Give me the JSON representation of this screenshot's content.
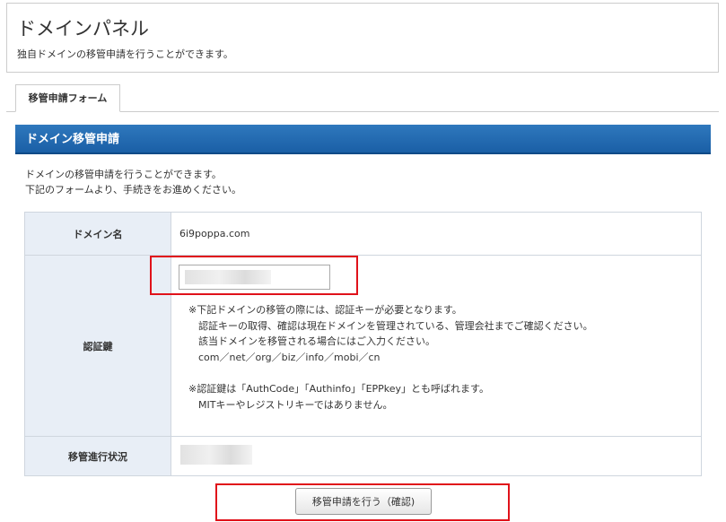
{
  "panel": {
    "title": "ドメインパネル",
    "description": "独自ドメインの移管申請を行うことができます。"
  },
  "tabs": [
    {
      "label": "移管申請フォーム",
      "active": true
    }
  ],
  "section": {
    "title": "ドメイン移管申請",
    "intro_line1": "ドメインの移管申請を行うことができます。",
    "intro_line2": "下記のフォームより、手続きをお進めください。"
  },
  "form": {
    "domain_label": "ドメイン名",
    "domain_value": "6i9poppa.com",
    "auth_label": "認証鍵",
    "auth_input_value": "",
    "auth_note1": "※下記ドメインの移管の際には、認証キーが必要となります。\n　認証キーの取得、確認は現在ドメインを管理されている、管理会社までご確認ください。\n　該当ドメインを移管される場合にはご入力ください。\n　com／net／org／biz／info／mobi／cn",
    "auth_note2": "※認証鍵は「AuthCode」「Authinfo」「EPPkey」とも呼ばれます。\n　MITキーやレジストリキーではありません。",
    "status_label": "移管進行状況",
    "status_value": ""
  },
  "submit": {
    "label": "移管申請を行う（確認)"
  },
  "colors": {
    "section_header": "#1a5fa6",
    "label_bg": "#e8eef6",
    "highlight": "#e0121a"
  }
}
